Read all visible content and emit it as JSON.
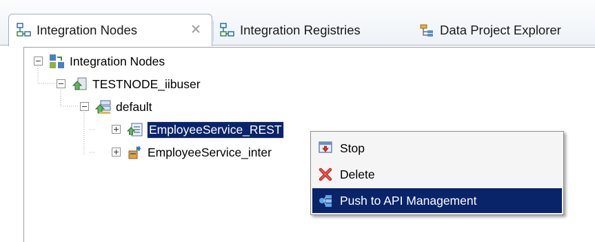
{
  "tabs": [
    {
      "label": "Integration Nodes",
      "icon": "integration-nodes-icon",
      "active": true,
      "close_icon": "close-icon"
    },
    {
      "label": "Integration Registries",
      "icon": "integration-registries-icon",
      "active": false
    },
    {
      "label": "Data Project Explorer",
      "icon": "data-project-explorer-icon",
      "active": false
    }
  ],
  "tree": {
    "root": {
      "label": "Integration Nodes",
      "icon": "integration-nodes-icon",
      "expanded": true
    },
    "node": {
      "label": "TESTNODE_iibuser",
      "icon": "integration-node-icon",
      "expanded": true
    },
    "server": {
      "label": "default",
      "icon": "integration-server-icon",
      "expanded": true
    },
    "items": [
      {
        "label": "EmployeeService_REST",
        "icon": "rest-api-icon",
        "expanded": false,
        "selected": true
      },
      {
        "label": "EmployeeService_inter",
        "icon": "application-icon",
        "expanded": false,
        "selected": false
      }
    ]
  },
  "context_menu": {
    "items": [
      {
        "label": "Stop",
        "icon": "stop-icon",
        "highlighted": false
      },
      {
        "label": "Delete",
        "icon": "delete-icon",
        "highlighted": false
      },
      {
        "label": "Push to API Management",
        "icon": "push-api-icon",
        "highlighted": true
      }
    ]
  },
  "colors": {
    "selection": "#0a246a",
    "tab_strip": "#eef2f7",
    "menu_background": "#f5f5f5"
  }
}
